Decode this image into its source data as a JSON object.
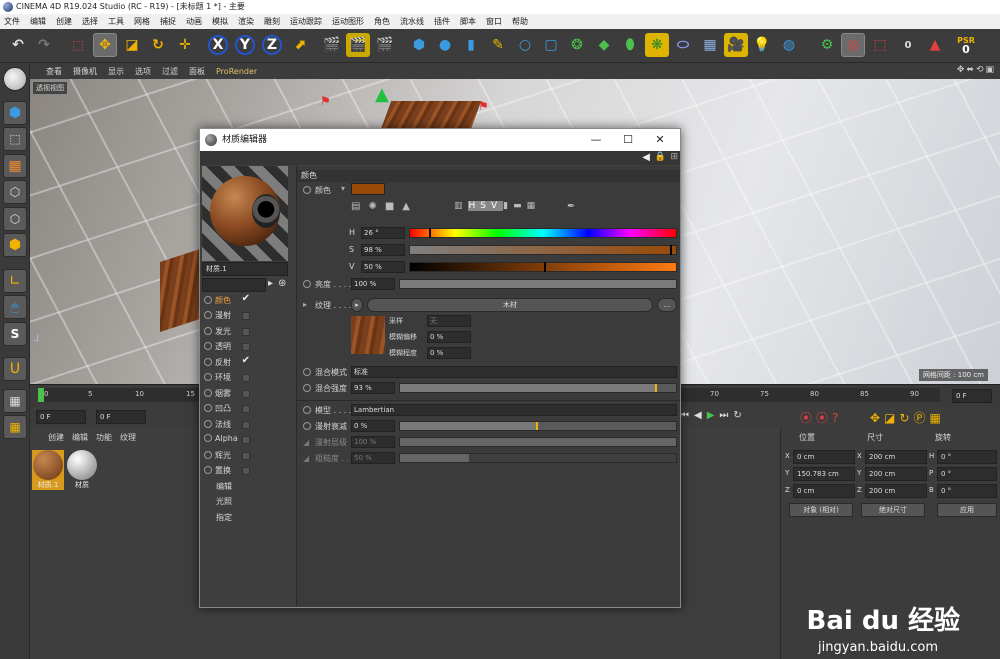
{
  "window": {
    "title": "CINEMA 4D R19.024 Studio (RC - R19) - [未标题 1 *] - 主要"
  },
  "menubar": [
    "文件",
    "编辑",
    "创建",
    "选择",
    "工具",
    "网格",
    "捕捉",
    "动画",
    "模拟",
    "渲染",
    "雕刻",
    "运动跟踪",
    "运动图形",
    "角色",
    "流水线",
    "插件",
    "脚本",
    "窗口",
    "帮助"
  ],
  "toolbar": {
    "axis_x": "X",
    "axis_y": "Y",
    "axis_z": "Z",
    "psr_label": "PSR",
    "psr_value": "0",
    "layer_value": "0"
  },
  "viewport_menu": [
    "查看",
    "摄像机",
    "显示",
    "选项",
    "过滤",
    "面板",
    "ProRender"
  ],
  "viewport": {
    "label": "透视视图",
    "grid_spacing": "网格间距 : 100 cm"
  },
  "timeline": {
    "ticks": [
      "0",
      "5",
      "10",
      "15",
      "65",
      "70",
      "75",
      "80",
      "85",
      "90"
    ],
    "frame_field": "0 F",
    "start_field": "0 F",
    "current_field": "0 F"
  },
  "object_manager": {
    "menu": [
      "创建",
      "编辑",
      "功能",
      "纹理"
    ],
    "materials": [
      {
        "name": "材质.1",
        "selected": true
      },
      {
        "name": "材质",
        "selected": false
      }
    ]
  },
  "attributes": {
    "headers": {
      "position": "位置",
      "size": "尺寸",
      "rotation": "旋转"
    },
    "rows": [
      {
        "axis": "X",
        "pos": "0 cm",
        "size_axis": "X",
        "size": "200 cm",
        "rot_axis": "H",
        "rot": "0 °"
      },
      {
        "axis": "Y",
        "pos": "150.783 cm",
        "size_axis": "Y",
        "size": "200 cm",
        "rot_axis": "P",
        "rot": "0 °"
      },
      {
        "axis": "Z",
        "pos": "0 cm",
        "size_axis": "Z",
        "size": "200 cm",
        "rot_axis": "B",
        "rot": "0 °"
      }
    ],
    "coord_mode": "对象 (相对)",
    "size_mode": "绝对尺寸",
    "apply_button": "应用"
  },
  "material_editor": {
    "title": "材质编辑器",
    "material_name": "材质.1",
    "channels": [
      {
        "name": "颜色",
        "checked": true,
        "active": true
      },
      {
        "name": "漫射",
        "checked": false
      },
      {
        "name": "发光",
        "checked": false
      },
      {
        "name": "透明",
        "checked": false
      },
      {
        "name": "反射",
        "checked": true
      },
      {
        "name": "环境",
        "checked": false
      },
      {
        "name": "烟雾",
        "checked": false
      },
      {
        "name": "凹凸",
        "checked": false
      },
      {
        "name": "法线",
        "checked": false
      },
      {
        "name": "Alpha",
        "checked": false
      },
      {
        "name": "辉光",
        "checked": false
      },
      {
        "name": "置换",
        "checked": false
      }
    ],
    "sub_items": [
      "编辑",
      "光照",
      "指定"
    ],
    "color_section": {
      "header": "颜色",
      "color_label": "颜色",
      "swatch": "#9a4a08",
      "h_label": "H",
      "h_value": "26 °",
      "h": 26,
      "s_label": "S",
      "s_value": "98 %",
      "s": 0.98,
      "v_label": "V",
      "v_value": "50 %",
      "v": 0.5,
      "brightness_label": "亮度 . . . .",
      "brightness_value": "100 %",
      "brightness": 1.0,
      "texture_label": "纹理 . . . .",
      "texture_name": "木材",
      "texture_more": "...",
      "sampling_label": "采样",
      "sampling_value": "无",
      "blur_offset_label": "模糊偏移",
      "blur_offset_value": "0 %",
      "blur_scale_label": "模糊程度",
      "blur_scale_value": "0 %",
      "mix_mode_label": "混合模式",
      "mix_mode_value": "标准",
      "mix_strength_label": "混合强度",
      "mix_strength_value": "93 %",
      "mix_strength": 0.93,
      "model_label": "模型 . . . .",
      "model_value": "Lambertian",
      "diffuse_falloff_label": "漫射衰减",
      "diffuse_falloff_value": "0 %",
      "diffuse_falloff": 0.5,
      "diffuse_level_label": "漫射层级",
      "diffuse_level_value": "100 %",
      "roughness_label": "粗糙度 . .",
      "roughness_value": "50 %",
      "roughness": 0.25
    }
  },
  "watermark": {
    "brand": "Bai du 经验",
    "url": "jingyan.baidu.com"
  },
  "colors": {
    "accent": "#f2a03c",
    "highlight": "#ddb400",
    "ui_bg": "#3c3c3c"
  }
}
